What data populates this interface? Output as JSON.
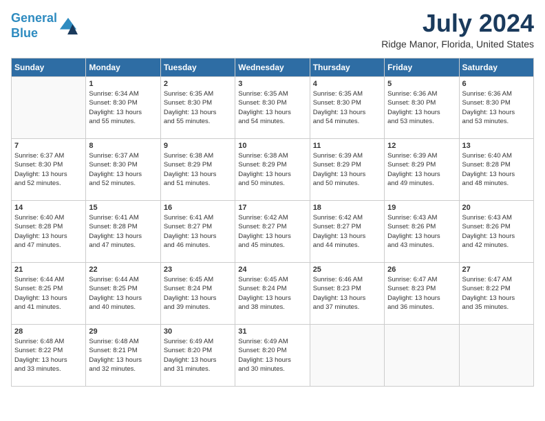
{
  "logo": {
    "line1": "General",
    "line2": "Blue"
  },
  "header": {
    "month_year": "July 2024",
    "location": "Ridge Manor, Florida, United States"
  },
  "days_of_week": [
    "Sunday",
    "Monday",
    "Tuesday",
    "Wednesday",
    "Thursday",
    "Friday",
    "Saturday"
  ],
  "weeks": [
    [
      {
        "day": "",
        "info": ""
      },
      {
        "day": "1",
        "info": "Sunrise: 6:34 AM\nSunset: 8:30 PM\nDaylight: 13 hours\nand 55 minutes."
      },
      {
        "day": "2",
        "info": "Sunrise: 6:35 AM\nSunset: 8:30 PM\nDaylight: 13 hours\nand 55 minutes."
      },
      {
        "day": "3",
        "info": "Sunrise: 6:35 AM\nSunset: 8:30 PM\nDaylight: 13 hours\nand 54 minutes."
      },
      {
        "day": "4",
        "info": "Sunrise: 6:35 AM\nSunset: 8:30 PM\nDaylight: 13 hours\nand 54 minutes."
      },
      {
        "day": "5",
        "info": "Sunrise: 6:36 AM\nSunset: 8:30 PM\nDaylight: 13 hours\nand 53 minutes."
      },
      {
        "day": "6",
        "info": "Sunrise: 6:36 AM\nSunset: 8:30 PM\nDaylight: 13 hours\nand 53 minutes."
      }
    ],
    [
      {
        "day": "7",
        "info": "Sunrise: 6:37 AM\nSunset: 8:30 PM\nDaylight: 13 hours\nand 52 minutes."
      },
      {
        "day": "8",
        "info": "Sunrise: 6:37 AM\nSunset: 8:30 PM\nDaylight: 13 hours\nand 52 minutes."
      },
      {
        "day": "9",
        "info": "Sunrise: 6:38 AM\nSunset: 8:29 PM\nDaylight: 13 hours\nand 51 minutes."
      },
      {
        "day": "10",
        "info": "Sunrise: 6:38 AM\nSunset: 8:29 PM\nDaylight: 13 hours\nand 50 minutes."
      },
      {
        "day": "11",
        "info": "Sunrise: 6:39 AM\nSunset: 8:29 PM\nDaylight: 13 hours\nand 50 minutes."
      },
      {
        "day": "12",
        "info": "Sunrise: 6:39 AM\nSunset: 8:29 PM\nDaylight: 13 hours\nand 49 minutes."
      },
      {
        "day": "13",
        "info": "Sunrise: 6:40 AM\nSunset: 8:28 PM\nDaylight: 13 hours\nand 48 minutes."
      }
    ],
    [
      {
        "day": "14",
        "info": "Sunrise: 6:40 AM\nSunset: 8:28 PM\nDaylight: 13 hours\nand 47 minutes."
      },
      {
        "day": "15",
        "info": "Sunrise: 6:41 AM\nSunset: 8:28 PM\nDaylight: 13 hours\nand 47 minutes."
      },
      {
        "day": "16",
        "info": "Sunrise: 6:41 AM\nSunset: 8:27 PM\nDaylight: 13 hours\nand 46 minutes."
      },
      {
        "day": "17",
        "info": "Sunrise: 6:42 AM\nSunset: 8:27 PM\nDaylight: 13 hours\nand 45 minutes."
      },
      {
        "day": "18",
        "info": "Sunrise: 6:42 AM\nSunset: 8:27 PM\nDaylight: 13 hours\nand 44 minutes."
      },
      {
        "day": "19",
        "info": "Sunrise: 6:43 AM\nSunset: 8:26 PM\nDaylight: 13 hours\nand 43 minutes."
      },
      {
        "day": "20",
        "info": "Sunrise: 6:43 AM\nSunset: 8:26 PM\nDaylight: 13 hours\nand 42 minutes."
      }
    ],
    [
      {
        "day": "21",
        "info": "Sunrise: 6:44 AM\nSunset: 8:25 PM\nDaylight: 13 hours\nand 41 minutes."
      },
      {
        "day": "22",
        "info": "Sunrise: 6:44 AM\nSunset: 8:25 PM\nDaylight: 13 hours\nand 40 minutes."
      },
      {
        "day": "23",
        "info": "Sunrise: 6:45 AM\nSunset: 8:24 PM\nDaylight: 13 hours\nand 39 minutes."
      },
      {
        "day": "24",
        "info": "Sunrise: 6:45 AM\nSunset: 8:24 PM\nDaylight: 13 hours\nand 38 minutes."
      },
      {
        "day": "25",
        "info": "Sunrise: 6:46 AM\nSunset: 8:23 PM\nDaylight: 13 hours\nand 37 minutes."
      },
      {
        "day": "26",
        "info": "Sunrise: 6:47 AM\nSunset: 8:23 PM\nDaylight: 13 hours\nand 36 minutes."
      },
      {
        "day": "27",
        "info": "Sunrise: 6:47 AM\nSunset: 8:22 PM\nDaylight: 13 hours\nand 35 minutes."
      }
    ],
    [
      {
        "day": "28",
        "info": "Sunrise: 6:48 AM\nSunset: 8:22 PM\nDaylight: 13 hours\nand 33 minutes."
      },
      {
        "day": "29",
        "info": "Sunrise: 6:48 AM\nSunset: 8:21 PM\nDaylight: 13 hours\nand 32 minutes."
      },
      {
        "day": "30",
        "info": "Sunrise: 6:49 AM\nSunset: 8:20 PM\nDaylight: 13 hours\nand 31 minutes."
      },
      {
        "day": "31",
        "info": "Sunrise: 6:49 AM\nSunset: 8:20 PM\nDaylight: 13 hours\nand 30 minutes."
      },
      {
        "day": "",
        "info": ""
      },
      {
        "day": "",
        "info": ""
      },
      {
        "day": "",
        "info": ""
      }
    ]
  ]
}
